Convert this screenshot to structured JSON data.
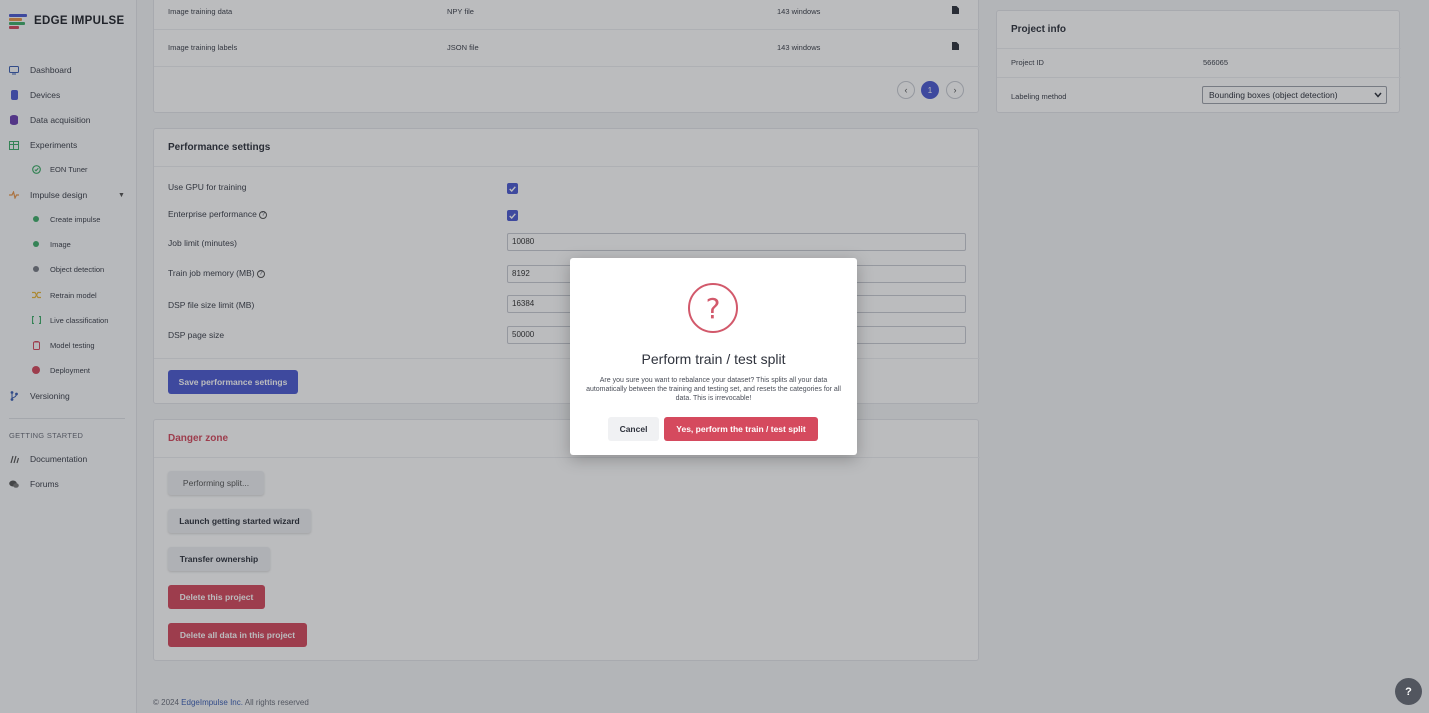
{
  "brand": {
    "name": "EDGE IMPULSE",
    "logo_colors": [
      "#4d5bd1",
      "#e8964a",
      "#3fae6a",
      "#d54a5e"
    ]
  },
  "sidebar": {
    "items": [
      {
        "label": "Dashboard",
        "icon": "monitor-icon",
        "color": "#3c5fb3"
      },
      {
        "label": "Devices",
        "icon": "device-icon",
        "color": "#4d5bd1"
      },
      {
        "label": "Data acquisition",
        "icon": "database-icon",
        "color": "#6a3fb0"
      },
      {
        "label": "Experiments",
        "icon": "table-icon",
        "color": "#3fae6a"
      },
      {
        "label": "EON Tuner",
        "icon": "target-icon",
        "color": "#3fae6a"
      },
      {
        "label": "Impulse design",
        "icon": "pulse-icon",
        "color": "#e8964a"
      },
      {
        "label": "Create impulse",
        "icon": "dot-icon",
        "color": "#3fae6a"
      },
      {
        "label": "Image",
        "icon": "dot-icon",
        "color": "#3fae6a"
      },
      {
        "label": "Object detection",
        "icon": "dot-icon",
        "color": "#777b85"
      },
      {
        "label": "Retrain model",
        "icon": "shuffle-icon",
        "color": "#e8b63a"
      },
      {
        "label": "Live classification",
        "icon": "bracket-icon",
        "color": "#3fae6a"
      },
      {
        "label": "Model testing",
        "icon": "flask-icon",
        "color": "#d54a5e"
      },
      {
        "label": "Deployment",
        "icon": "rocket-icon",
        "color": "#d54a5e"
      },
      {
        "label": "Versioning",
        "icon": "branch-icon",
        "color": "#3c5fb3"
      }
    ],
    "getting_started_heading": "GETTING STARTED",
    "getting_started": [
      {
        "label": "Documentation",
        "icon": "book-icon"
      },
      {
        "label": "Forums",
        "icon": "chat-icon"
      }
    ]
  },
  "export_table": {
    "rows": [
      {
        "name": "Image training data",
        "format": "NPY file",
        "size": "143 windows",
        "icon": "file-icon"
      },
      {
        "name": "Image training labels",
        "format": "JSON file",
        "size": "143 windows",
        "icon": "file-icon"
      }
    ],
    "pager": {
      "prev": "‹",
      "current": "1",
      "next": "›"
    }
  },
  "performance": {
    "title": "Performance settings",
    "use_gpu_label": "Use GPU for training",
    "use_gpu_checked": true,
    "enterprise_label": "Enterprise performance",
    "enterprise_checked": true,
    "job_limit_label": "Job limit (minutes)",
    "job_limit_value": "10080",
    "train_memory_label": "Train job memory (MB)",
    "train_memory_value": "8192",
    "dsp_file_label": "DSP file size limit (MB)",
    "dsp_file_value": "16384",
    "dsp_page_label": "DSP page size",
    "dsp_page_value": "50000",
    "save_button": "Save performance settings"
  },
  "danger": {
    "title": "Danger zone",
    "performing_split": "Performing split...",
    "launch_wizard": "Launch getting started wizard",
    "transfer": "Transfer ownership",
    "delete_project": "Delete this project",
    "delete_all": "Delete all data in this project"
  },
  "project_info": {
    "title": "Project info",
    "project_id_label": "Project ID",
    "project_id": "566065",
    "labeling_label": "Labeling method",
    "labeling_value": "Bounding boxes (object detection)"
  },
  "footer": {
    "prefix": "© 2024",
    "company": "EdgeImpulse Inc.",
    "suffix": "All rights reserved"
  },
  "modal": {
    "icon": "?",
    "title": "Perform train / test split",
    "body": "Are you sure you want to rebalance your dataset? This splits all your data automatically between the training and testing set, and resets the categories for all data. This is irrevocable!",
    "cancel": "Cancel",
    "confirm": "Yes, perform the train / test split"
  },
  "help_icon": "?"
}
